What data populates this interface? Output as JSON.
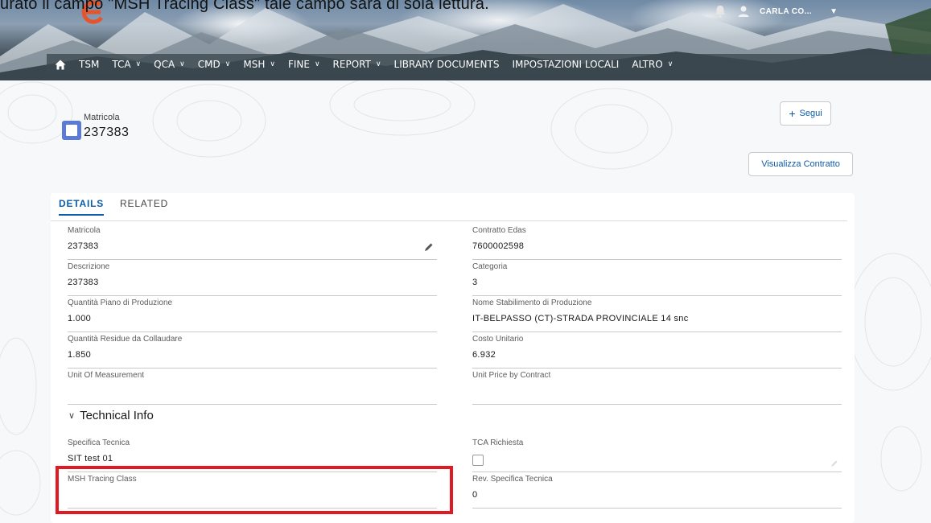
{
  "caption": "urato il campo \"MSH Tracing Class\" tale campo sarà di sola lettura.",
  "header": {
    "user_name": "CARLA CO...",
    "icons": [
      "app-logo",
      "bell-icon",
      "user-avatar-icon",
      "chevron-down-icon"
    ]
  },
  "nav": {
    "items": [
      {
        "label": "TSM",
        "chevron": false
      },
      {
        "label": "TCA",
        "chevron": true
      },
      {
        "label": "QCA",
        "chevron": true
      },
      {
        "label": "CMD",
        "chevron": true
      },
      {
        "label": "MSH",
        "chevron": true
      },
      {
        "label": "FINE",
        "chevron": true
      },
      {
        "label": "REPORT",
        "chevron": true
      },
      {
        "label": "LIBRARY DOCUMENTS",
        "chevron": false
      },
      {
        "label": "IMPOSTAZIONI LOCALI",
        "chevron": false
      },
      {
        "label": "ALTRO",
        "chevron": true
      }
    ],
    "chevron_glyph": "∨"
  },
  "record": {
    "type": "Matricola",
    "name": "237383",
    "follow_label": "Segui",
    "contract_button": "Visualizza Contratto"
  },
  "tabs": {
    "details": "DETAILS",
    "related": "RELATED"
  },
  "fields": {
    "matricola": {
      "label": "Matricola",
      "value": "237383"
    },
    "contratto_edas": {
      "label": "Contratto Edas",
      "value": "7600002598"
    },
    "descrizione": {
      "label": "Descrizione",
      "value": "237383"
    },
    "categoria": {
      "label": "Categoria",
      "value": "3"
    },
    "quantita_piano": {
      "label": "Quantità Piano di Produzione",
      "value": "1.000"
    },
    "nome_stabilimento": {
      "label": "Nome Stabilimento di Produzione",
      "value": "IT-BELPASSO (CT)-STRADA PROVINCIALE 14 snc"
    },
    "quantita_residue": {
      "label": "Quantità Residue da Collaudare",
      "value": "1.850"
    },
    "costo_unitario": {
      "label": "Costo Unitario",
      "value": "6.932"
    },
    "unit_of_measurement": {
      "label": "Unit Of Measurement",
      "value": ""
    },
    "unit_price_contract": {
      "label": "Unit Price by Contract",
      "value": ""
    }
  },
  "technical_info": {
    "section_title": "Technical Info",
    "specifica_tecnica": {
      "label": "Specifica Tecnica",
      "value": "SIT test 01"
    },
    "tca_richiesta": {
      "label": "TCA Richiesta",
      "checked": false
    },
    "msh_tracing_class": {
      "label": "MSH Tracing Class",
      "value": ""
    },
    "rev_specifica_tecnica": {
      "label": "Rev. Specifica Tecnica",
      "value": "0"
    }
  },
  "colors": {
    "highlight": "#e01a22",
    "accent": "#0b5cab",
    "record_icon": "#5b7bd5"
  }
}
